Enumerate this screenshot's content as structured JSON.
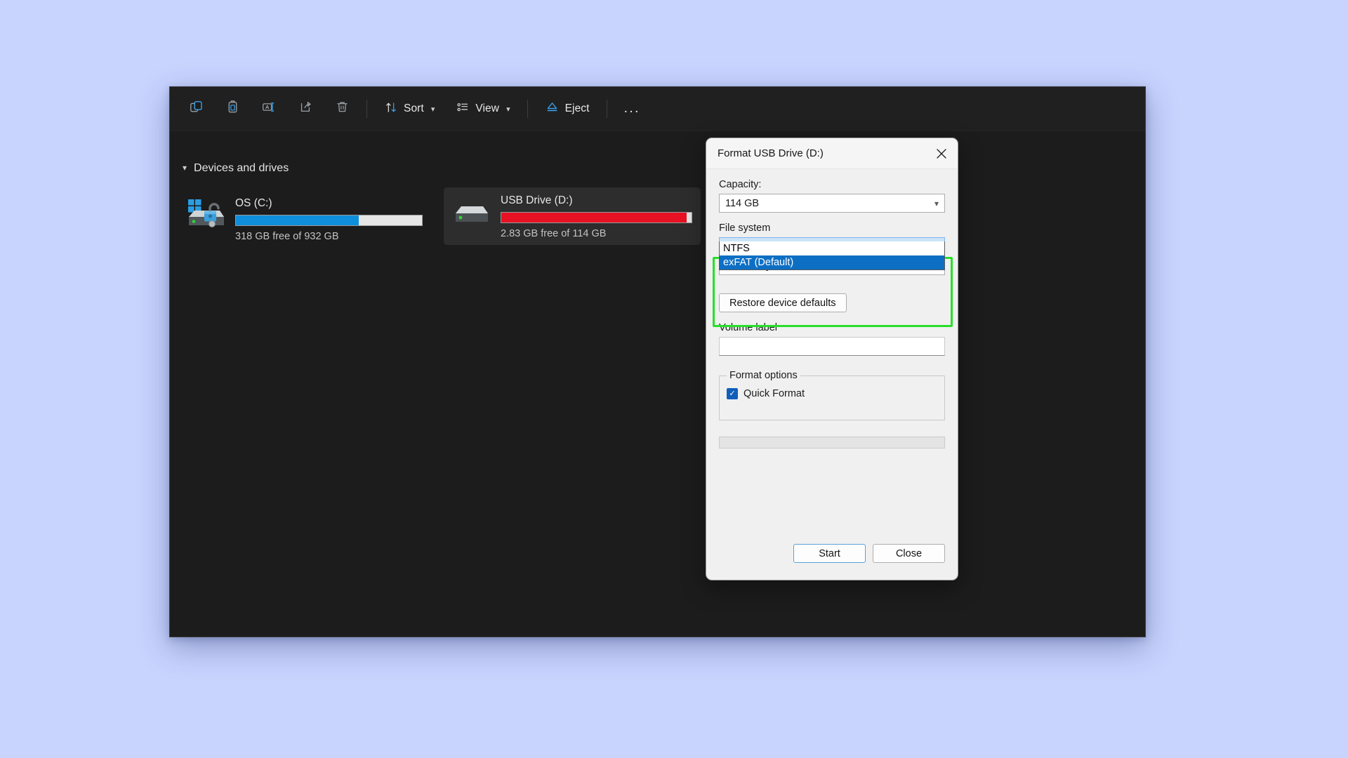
{
  "desktop": {
    "background_color": "#c8d3fe"
  },
  "explorer": {
    "toolbar": {
      "items": [
        {
          "icon": "copy-icon",
          "label": ""
        },
        {
          "icon": "paste-icon",
          "label": ""
        },
        {
          "icon": "rename-icon",
          "label": ""
        },
        {
          "icon": "share-icon",
          "label": ""
        },
        {
          "icon": "delete-icon",
          "label": ""
        }
      ],
      "sort_label": "Sort",
      "view_label": "View",
      "eject_label": "Eject",
      "more_label": "..."
    },
    "group_header": "Devices and drives",
    "drives": [
      {
        "name": "OS (C:)",
        "usage_text": "318 GB free of 932 GB",
        "used_percent": 66,
        "bar_color": "#0f8fdb",
        "selected": false,
        "icon": "windows-drive-bitlocker-unlocked-icon"
      },
      {
        "name": "USB Drive (D:)",
        "usage_text": "2.83 GB free of 114 GB",
        "used_percent": 97.5,
        "bar_color": "#e81123",
        "selected": true,
        "icon": "usb-drive-icon"
      }
    ]
  },
  "dialog": {
    "title": "Format USB Drive (D:)",
    "close_icon": "close-icon",
    "capacity_label": "Capacity:",
    "capacity_value": "114 GB",
    "file_system_label": "File system",
    "file_system_value": "exFAT (Default)",
    "file_system_options": [
      {
        "label": "NTFS",
        "selected": false
      },
      {
        "label": "exFAT (Default)",
        "selected": true
      }
    ],
    "allocation_value": "128 kilobytes",
    "restore_defaults_label": "Restore device defaults",
    "volume_label_label": "Volume label",
    "volume_label_value": "",
    "volume_label_placeholder": "",
    "format_options_label": "Format options",
    "quick_format_label": "Quick Format",
    "quick_format_checked": true,
    "progress_value": 0,
    "start_label": "Start",
    "close_label": "Close",
    "highlight_color": "#27e02a"
  }
}
